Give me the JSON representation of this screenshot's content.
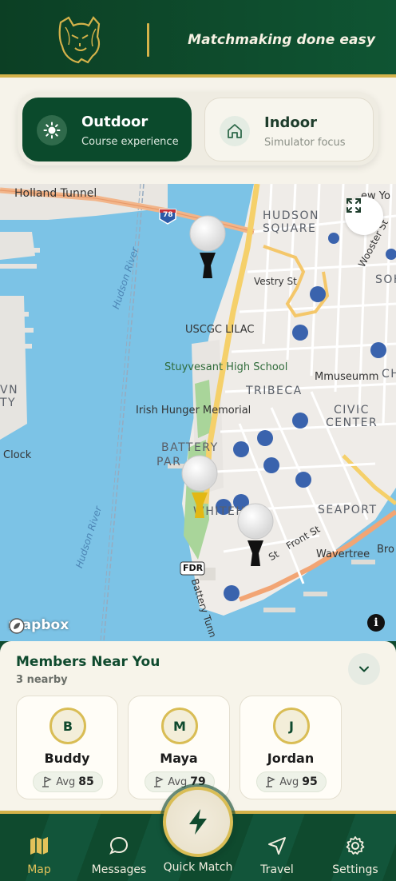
{
  "header": {
    "tagline": "Matchmaking done easy",
    "logo_icon": "wildcat-logo-icon"
  },
  "modes": {
    "selected": "outdoor",
    "outdoor": {
      "title": "Outdoor",
      "subtitle": "Course experience",
      "icon": "sun-icon"
    },
    "indoor": {
      "title": "Indoor",
      "subtitle": "Simulator focus",
      "icon": "home-icon"
    }
  },
  "map": {
    "labels": {
      "holland_tunnel": "Holland Tunnel",
      "hudson_square": "HUDSON",
      "hudson_square_2": "SQUARE",
      "hudson_river_top": "Hudson River",
      "hudson_river_bottom": "Hudson River",
      "vestry_st": "Vestry St",
      "uscgc_lilac": "USCGC LILAC",
      "stuyvesant": "Stuyvesant High School",
      "tribeca": "TRIBECA",
      "mmuseumm": "Mmuseumm",
      "civic": "CIVIC",
      "center": "CENTER",
      "irish_hunger": "Irish Hunger Memorial",
      "battery": "BATTERY",
      "park": "PAR",
      "clock": "Clock",
      "seaport": "SEAPORT",
      "whitehall": "WHITEHA",
      "front_st": "Front St",
      "wavertree": "Wavertree",
      "fdr": "FDR",
      "battery_tunnel": "Battery Tunn",
      "wooster": "Wooster St",
      "new_york": "ew Yo",
      "soh": "SOH",
      "ch": "CH",
      "bro": "Bro",
      "vn": "VN",
      "ty": "TY",
      "st_label": "St",
      "i78": "78"
    },
    "attribution": "mapbox",
    "info_label": "i"
  },
  "members": {
    "title": "Members Near You",
    "count_label": "3 nearby",
    "list": [
      {
        "initial": "B",
        "name": "Buddy",
        "avg_label": "Avg",
        "avg": "85"
      },
      {
        "initial": "M",
        "name": "Maya",
        "avg_label": "Avg",
        "avg": "79"
      },
      {
        "initial": "J",
        "name": "Jordan",
        "avg_label": "Avg",
        "avg": "95"
      }
    ]
  },
  "nav": {
    "active": "map",
    "items": [
      {
        "label": "Map",
        "icon": "map-icon"
      },
      {
        "label": "Messages",
        "icon": "chat-bubble-icon"
      },
      {
        "label": "Quick Match",
        "icon": "lightning-icon"
      },
      {
        "label": "Travel",
        "icon": "navigation-arrow-icon"
      },
      {
        "label": "Settings",
        "icon": "gear-icon"
      }
    ]
  },
  "colors": {
    "brand_green": "#0f4a2e",
    "gold": "#d4b24a",
    "cream": "#f7f4ea"
  }
}
